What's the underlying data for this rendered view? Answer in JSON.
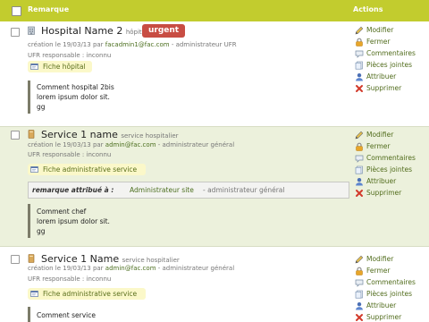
{
  "table": {
    "header": {
      "remarque": "Remarque",
      "actions": "Actions"
    },
    "rows": [
      {
        "title": "Hospital Name 2",
        "type": "hôpital",
        "badge": "urgent",
        "meta_prefix": "création le 19/03/13 par",
        "email": "facadmin1@fac.com",
        "meta_suffix": "- administrateur UFR",
        "ufr": "UFR responsable : inconnu",
        "fiche": "Fiche hôpital",
        "comment": [
          "Comment hospital 2bis",
          "lorem ipsum dolor sit.",
          "gg"
        ]
      },
      {
        "title": "Service 1 name",
        "type": "service hospitalier",
        "meta_prefix": "création le 19/03/13 par",
        "email": "admin@fac.com",
        "meta_suffix": "- administrateur général",
        "ufr": "UFR responsable : inconnu",
        "fiche": "Fiche administrative service",
        "assign": {
          "label": "remarque attribué à :",
          "name": "Administrateur site",
          "role": "- administrateur général"
        },
        "comment": [
          "Comment chef",
          "lorem ipsum dolor sit.",
          "gg"
        ]
      },
      {
        "title": "Service 1 Name",
        "type": "service hospitalier",
        "meta_prefix": "création le 19/03/13 par",
        "email": "admin@fac.com",
        "meta_suffix": "- administrateur général",
        "ufr": "UFR responsable : inconnu",
        "fiche": "Fiche administrative service",
        "comment": [
          "Comment service"
        ]
      }
    ],
    "actions": [
      {
        "label": "Modifier",
        "icon": "pencil-icon"
      },
      {
        "label": "Fermer",
        "icon": "lock-icon"
      },
      {
        "label": "Commentaires",
        "icon": "comment-icon"
      },
      {
        "label": "Pièces jointes",
        "icon": "attachment-icon"
      },
      {
        "label": "Attribuer",
        "icon": "assign-user-icon"
      },
      {
        "label": "Supprimer",
        "icon": "delete-icon"
      }
    ]
  },
  "colors": {
    "header": "#c2cc2e",
    "alt_row": "#ecf1dc",
    "badge": "#c84d43",
    "link": "#516c1c",
    "fiche_bg": "#fbf8c9"
  }
}
